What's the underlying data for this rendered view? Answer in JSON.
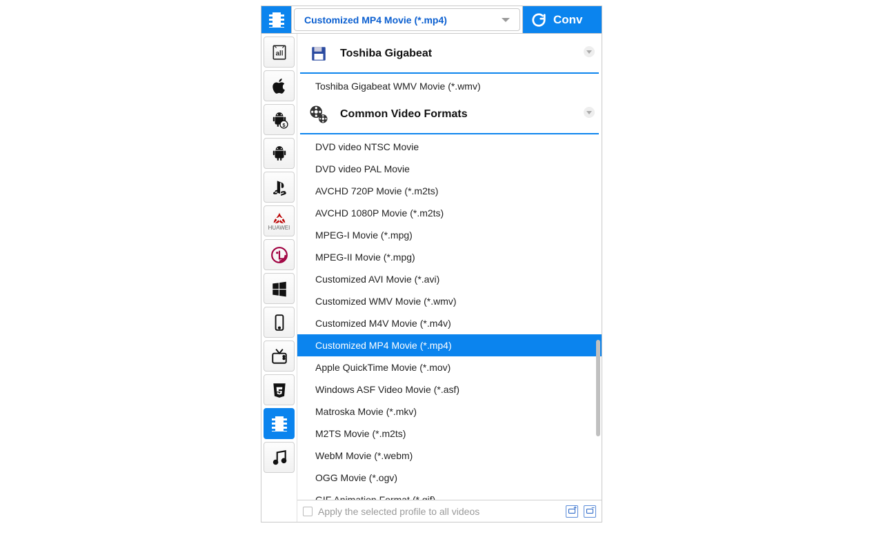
{
  "topbar": {
    "selected_format": "Customized MP4 Movie (*.mp4)",
    "convert_label": "Conv"
  },
  "sidebar": {
    "icons": [
      "all-icon",
      "apple-icon",
      "android-paid-icon",
      "android-icon",
      "playstation-icon",
      "huawei-icon",
      "lg-icon",
      "windows-icon",
      "mobile-icon",
      "tv-icon",
      "html5-icon",
      "video-icon",
      "music-icon"
    ],
    "active_index": 11
  },
  "groups": [
    {
      "icon": "floppy-icon",
      "title": "Toshiba Gigabeat",
      "items": [
        "Toshiba Gigabeat WMV Movie (*.wmv)"
      ]
    },
    {
      "icon": "film-reel-icon",
      "title": "Common Video Formats",
      "items": [
        "DVD video NTSC Movie",
        "DVD video PAL Movie",
        "AVCHD 720P Movie (*.m2ts)",
        "AVCHD 1080P Movie (*.m2ts)",
        "MPEG-I Movie (*.mpg)",
        "MPEG-II Movie (*.mpg)",
        "Customized AVI Movie (*.avi)",
        "Customized WMV Movie (*.wmv)",
        "Customized M4V Movie (*.m4v)",
        "Customized MP4 Movie (*.mp4)",
        "Apple QuickTime Movie (*.mov)",
        "Windows ASF Video Movie (*.asf)",
        "Matroska Movie (*.mkv)",
        "M2TS Movie (*.m2ts)",
        "WebM Movie (*.webm)",
        "OGG Movie (*.ogv)",
        "GIF Animation Format (*.gif)"
      ]
    }
  ],
  "selected_item": "Customized MP4 Movie (*.mp4)",
  "footer": {
    "apply_label": "Apply the selected profile to all videos"
  }
}
